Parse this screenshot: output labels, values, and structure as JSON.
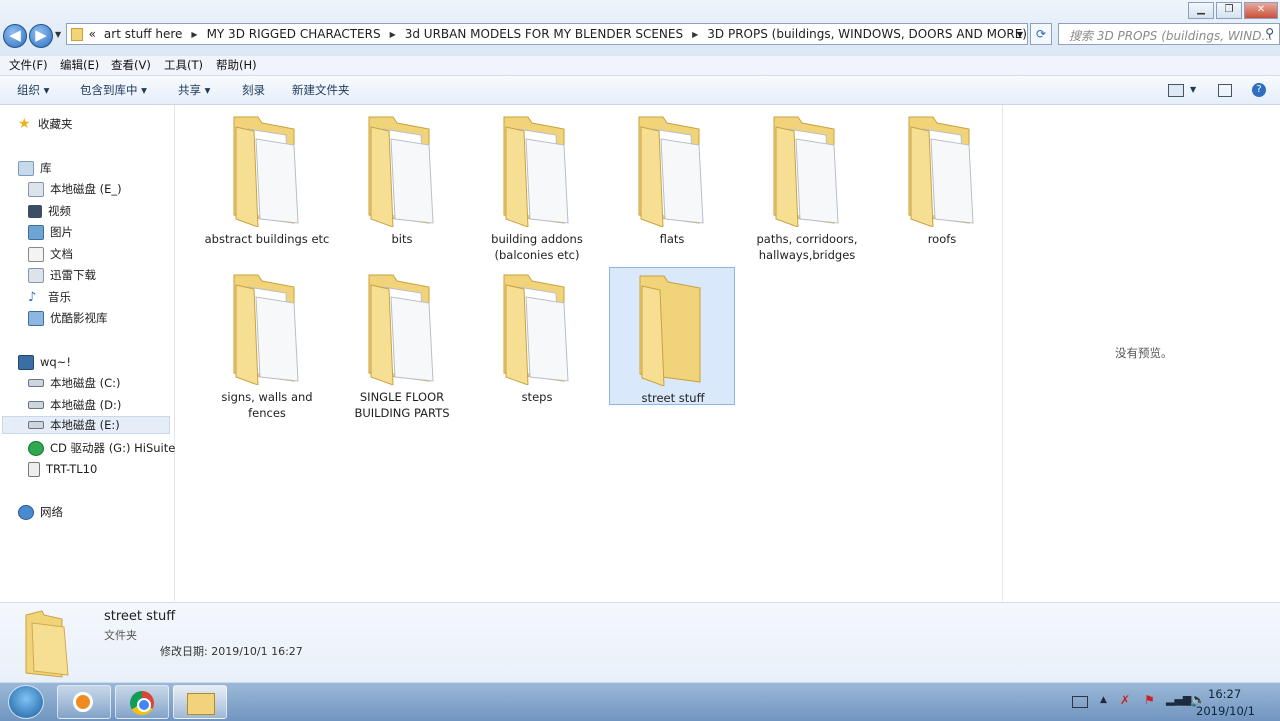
{
  "breadcrumb": {
    "overflow": "«",
    "items": [
      "art stuff here",
      "MY 3D RIGGED CHARACTERS",
      "3d URBAN MODELS FOR MY BLENDER SCENES",
      "3D PROPS (buildings, WINDOWS, DOORS AND MORE)"
    ]
  },
  "search": {
    "placeholder": "搜索 3D PROPS (buildings, WIND..."
  },
  "menu": [
    "文件(F)",
    "编辑(E)",
    "查看(V)",
    "工具(T)",
    "帮助(H)"
  ],
  "toolbar": {
    "organize": "组织 ▾",
    "include": "包含到库中 ▾",
    "share": "共享 ▾",
    "burn": "刻录",
    "new_folder": "新建文件夹"
  },
  "nav": {
    "favorites": "收藏夹",
    "libraries": "库",
    "lib_items": [
      "本地磁盘 (E_)",
      "视频",
      "图片",
      "文档",
      "迅雷下载",
      "音乐",
      "优酷影视库"
    ],
    "computer": "wq~!",
    "drives": [
      "本地磁盘 (C:)",
      "本地磁盘 (D:)",
      "本地磁盘 (E:)",
      "CD 驱动器 (G:) HiSuite",
      "TRT-TL10"
    ],
    "network": "网络"
  },
  "folders": [
    {
      "name": "abstract buildings etc"
    },
    {
      "name": "bits"
    },
    {
      "name": "building addons (balconies etc)"
    },
    {
      "name": "flats"
    },
    {
      "name": "paths, corridoors, hallways,bridges"
    },
    {
      "name": "roofs"
    },
    {
      "name": "signs, walls and fences"
    },
    {
      "name": "SINGLE FLOOR BUILDING PARTS"
    },
    {
      "name": "steps"
    },
    {
      "name": "street stuff"
    }
  ],
  "preview": {
    "text": "没有预览。"
  },
  "details": {
    "name": "street stuff",
    "type": "文件夹",
    "modified": "修改日期: 2019/10/1 16:27"
  },
  "clock": {
    "time": "16:27",
    "date": "2019/10/1"
  },
  "colors": {
    "accent": "#2f6fc0",
    "folder": "#f1d37a",
    "selection": "#d9e8fb"
  }
}
